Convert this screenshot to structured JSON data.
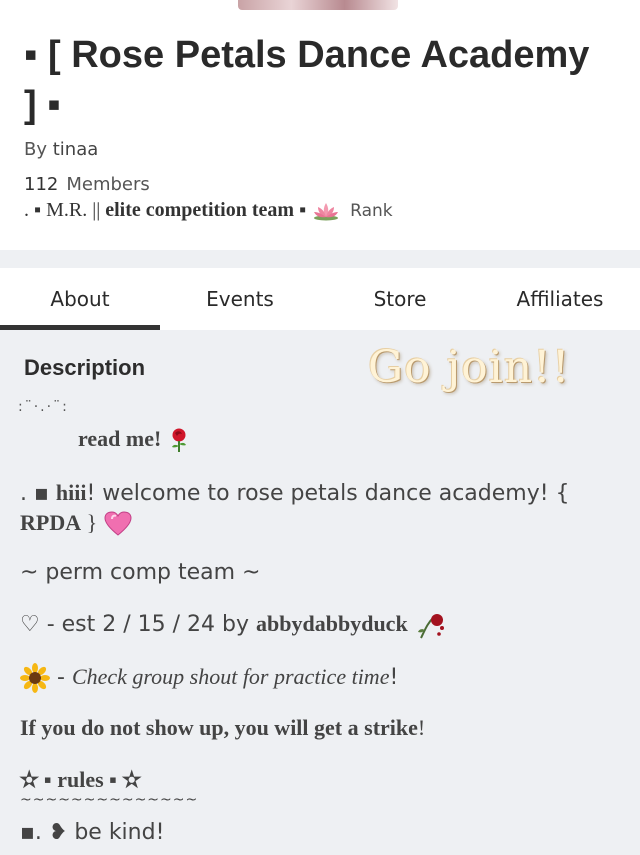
{
  "group": {
    "title_line1": "▪ [ Rose Petals Dance Academy",
    "title_line2": "] ▪",
    "by_label": "By",
    "owner": "tinaa",
    "member_count": "112",
    "members_label": "Members",
    "rank_prefix": ". ▪ M.R. || ",
    "rank_name": "elite competition team",
    "rank_suffix": " ▪",
    "rank_label": "Rank"
  },
  "tabs": [
    "About",
    "Events",
    "Store",
    "Affiliates"
  ],
  "description": {
    "heading": "Description",
    "overlay_text": "Go join!!",
    "dots": ":¨·.·¨:",
    "read_me": "read me!",
    "welcome_prefix": ". ▪ ",
    "welcome_bold": "hiii",
    "welcome_rest": "! welcome to rose petals dance academy! {",
    "welcome_tag": "RPDA",
    "welcome_close": " }",
    "perm": "~ perm comp team ~",
    "est_prefix": "♡ - est 2 / 15 / 24 by ",
    "est_user": "abbydabbyduck",
    "practice_dash": " - ",
    "practice": "Check group shout for practice time",
    "practice_end": "!",
    "strike": "If you do not show up, you will get a strike",
    "strike_end": "!",
    "rules": "✫ ▪ rules ▪ ✫",
    "tilde": "~~~~~~~~~~~~~~",
    "kind": "▪. ❥ be kind!"
  },
  "colors": {
    "tab_indicator": "#333333",
    "background": "#eef0f3"
  }
}
